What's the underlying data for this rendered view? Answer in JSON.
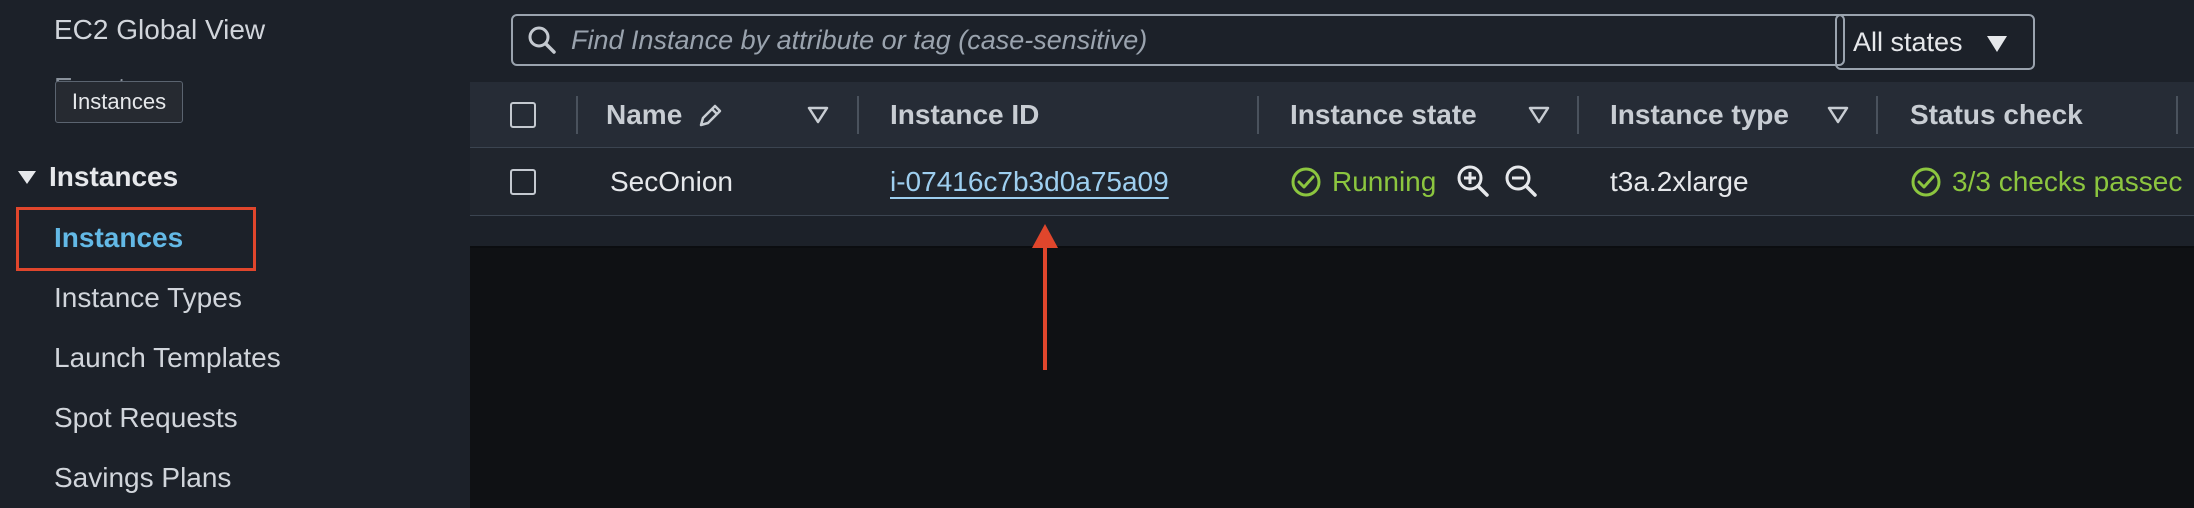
{
  "sidebar": {
    "global_view": "EC2 Global View",
    "hidden_item": "Events",
    "tooltip": "Instances",
    "section": "Instances",
    "items": [
      "Instances",
      "Instance Types",
      "Launch Templates",
      "Spot Requests",
      "Savings Plans"
    ],
    "active_item": "Instances"
  },
  "toolbar": {
    "search_placeholder": "Find Instance by attribute or tag (case-sensitive)",
    "states_filter": "All states"
  },
  "table": {
    "columns": [
      "Name",
      "Instance ID",
      "Instance state",
      "Instance type",
      "Status check"
    ],
    "rows": [
      {
        "name": "SecOnion",
        "instance_id": "i-07416c7b3d0a75a09",
        "state": "Running",
        "type": "t3a.2xlarge",
        "status_check": "3/3 checks passec"
      }
    ]
  },
  "colors": {
    "accent_link": "#9ecff0",
    "active_nav": "#63b9e6",
    "running_green": "#8cc63f",
    "annotation_red": "#e0462c"
  },
  "icons": [
    "search-icon",
    "dropdown-caret-icon",
    "edit-pencil-icon",
    "sort-filter-icon",
    "check-circle-icon",
    "zoom-in-icon",
    "zoom-out-icon",
    "expand-triangle-icon",
    "annotation-arrow"
  ]
}
